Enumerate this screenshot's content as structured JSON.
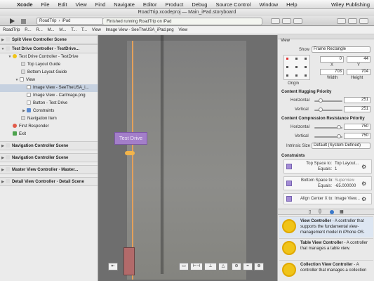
{
  "menubar": {
    "apple": "",
    "items": [
      "Xcode",
      "File",
      "Edit",
      "View",
      "Find",
      "Navigate",
      "Editor",
      "Product",
      "Debug",
      "Source Control",
      "Window",
      "Help"
    ],
    "right": "Wiley Publishing"
  },
  "titlebar": {
    "project": "RoadTrip.xcodeproj",
    "separator": "—",
    "file": "Main_iPad.storyboard"
  },
  "toolbar": {
    "scheme_app": "RoadTrip",
    "scheme_device": "iPad",
    "activity": "Finished running RoadTrip on iPad"
  },
  "jumpbar": [
    "RoadTrip",
    "R...",
    "R...",
    "M...",
    "M...",
    "T...",
    "T...",
    "View",
    "Image View - SeeTheUSA_iPad.png",
    "View"
  ],
  "navigator": {
    "rows": [
      {
        "label": "Split View Controller Scene",
        "level": 0,
        "type": "scene"
      },
      {
        "label": "Test Drive Controller - TestDrive...",
        "level": 0,
        "type": "scene"
      },
      {
        "label": "Test Drive Controller - TestDrive",
        "level": 1
      },
      {
        "label": "Top Layout Guide",
        "level": 2
      },
      {
        "label": "Bottom Layout Guide",
        "level": 2
      },
      {
        "label": "View",
        "level": 2
      },
      {
        "label": "Image View - SeeTheUSA_i...",
        "level": 3,
        "selected": true
      },
      {
        "label": "Image View - CarImage.png",
        "level": 3
      },
      {
        "label": "Button - Test Drive",
        "level": 3
      },
      {
        "label": "Constraints",
        "level": 3
      },
      {
        "label": "Navigation Item",
        "level": 2
      },
      {
        "label": "First Responder",
        "level": 1
      },
      {
        "label": "Exit",
        "level": 1
      },
      {
        "label": "Navigation Controller Scene",
        "level": 0,
        "type": "scene"
      },
      {
        "label": "Navigation Controller Scene",
        "level": 0,
        "type": "scene"
      },
      {
        "label": "Master View Controller - Master...",
        "level": 0,
        "type": "scene"
      },
      {
        "label": "Detail View Controller - Detail Scene",
        "level": 0,
        "type": "scene"
      }
    ]
  },
  "canvas": {
    "button_label": "Test Drive"
  },
  "inspector": {
    "header": "View",
    "show_label": "Show",
    "show_value": "Frame Rectangle",
    "origin_label": "Origin",
    "x_label": "X",
    "y_label": "Y",
    "x": "0",
    "y": "44",
    "width_label": "Width",
    "height_label": "Height",
    "width": "703",
    "height": "704",
    "hugging": {
      "title": "Content Hugging Priority",
      "h_label": "Horizontal",
      "h": "251",
      "v_label": "Vertical",
      "v": "251"
    },
    "compression": {
      "title": "Content Compression Resistance Priority",
      "h_label": "Horizontal",
      "h": "750",
      "v_label": "Vertical",
      "v": "750"
    },
    "intrinsic_label": "Intrinsic Size",
    "intrinsic_value": "Default (System Defined)",
    "constraints_title": "Constraints",
    "constraints": [
      {
        "l1": "Top Space to:",
        "r1": "Top Layout...",
        "l2": "Equals:",
        "r2": "1"
      },
      {
        "l1": "Bottom Space to:",
        "r1": "Superview",
        "l2": "Equals:",
        "r2": "-65.000000"
      },
      {
        "l1": "Align Center X to:",
        "r1": "Image View..."
      }
    ],
    "library": [
      {
        "title": "View Controller",
        "desc": " - A controller that supports the fundamental view-management model in iPhone OS."
      },
      {
        "title": "Table View Controller",
        "desc": " - A controller that manages a table view."
      },
      {
        "title": "Collection View Controller",
        "desc": " - A controller that manages a collection"
      }
    ]
  }
}
